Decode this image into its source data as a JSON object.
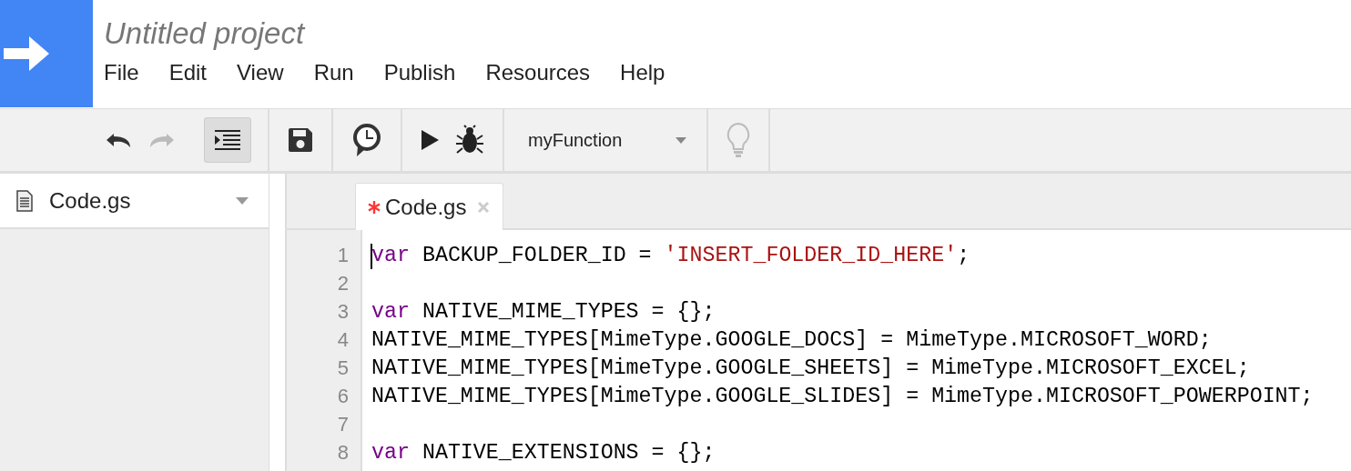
{
  "project_title": "Untitled project",
  "menu": [
    "File",
    "Edit",
    "View",
    "Run",
    "Publish",
    "Resources",
    "Help"
  ],
  "toolbar": {
    "undo": {
      "disabled": false
    },
    "redo": {
      "disabled": true
    },
    "indent": {
      "selected": true
    },
    "function_select": {
      "value": "myFunction"
    },
    "hint": {
      "disabled": true
    }
  },
  "sidebar": {
    "file": "Code.gs"
  },
  "tabs": [
    {
      "label": "Code.gs",
      "modified": true,
      "selected": true
    }
  ],
  "code_lines": [
    {
      "number": "1",
      "tokens": [
        {
          "kind": "keyword",
          "text": "var"
        },
        {
          "kind": "plain",
          "text": " BACKUP_FOLDER_ID = "
        },
        {
          "kind": "string",
          "text": "'INSERT_FOLDER_ID_HERE'"
        },
        {
          "kind": "plain",
          "text": ";"
        }
      ]
    },
    {
      "number": "2"
    },
    {
      "number": "3",
      "tokens": [
        {
          "kind": "keyword",
          "text": "var"
        },
        {
          "kind": "plain",
          "text": " NATIVE_MIME_TYPES = {};"
        }
      ]
    },
    {
      "number": "4",
      "tokens": [
        {
          "kind": "plain",
          "text": "NATIVE_MIME_TYPES[MimeType.GOOGLE_DOCS] = MimeType.MICROSOFT_WORD;"
        }
      ]
    },
    {
      "number": "5",
      "tokens": [
        {
          "kind": "plain",
          "text": "NATIVE_MIME_TYPES[MimeType.GOOGLE_SHEETS] = MimeType.MICROSOFT_EXCEL;"
        }
      ]
    },
    {
      "number": "6",
      "tokens": [
        {
          "kind": "plain",
          "text": "NATIVE_MIME_TYPES[MimeType.GOOGLE_SLIDES] = MimeType.MICROSOFT_POWERPOINT;"
        }
      ]
    },
    {
      "number": "7"
    },
    {
      "number": "8",
      "tokens": [
        {
          "kind": "keyword",
          "text": "var"
        },
        {
          "kind": "plain",
          "text": " NATIVE_EXTENSIONS = {};"
        }
      ]
    }
  ]
}
